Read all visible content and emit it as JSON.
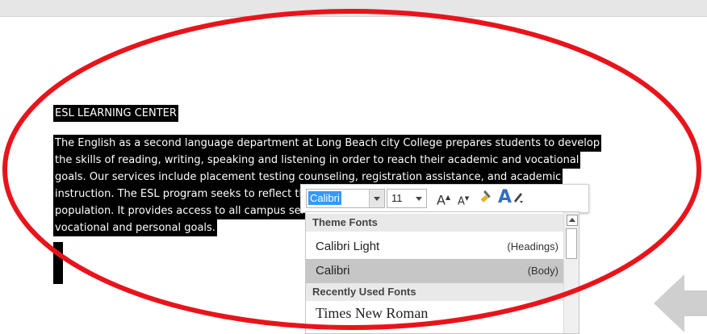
{
  "document": {
    "heading": "ESL LEARNING CENTER",
    "lines": [
      "The English  as a second language department at Long Beach city College prepares students to develop",
      "the skills  of reading, writing, speaking and listening in order to reach their academic and vocational",
      "goals.  Our services include placement testing counseling, registration assistance, and academic",
      "instruction. The ESL program seeks to reflect the needs of our increasingly changing student",
      "population. It provides access to all campus services to help students achieve academic,",
      "vocational and personal goals."
    ]
  },
  "mini_toolbar": {
    "font_value": "Calibri",
    "size_value": "11",
    "grow_font": "A",
    "shrink_font": "A",
    "font_color": "A"
  },
  "font_dropdown": {
    "theme_header": "Theme Fonts",
    "theme_fonts": [
      {
        "name": "Calibri Light",
        "tag": "(Headings)"
      },
      {
        "name": "Calibri",
        "tag": "(Body)"
      }
    ],
    "recent_header": "Recently Used Fonts",
    "recent_fonts": [
      {
        "name": "Times New Roman"
      }
    ]
  },
  "colors": {
    "annotation": "#e8141b",
    "selection": "#000000",
    "text_highlight": "#3399ff"
  }
}
